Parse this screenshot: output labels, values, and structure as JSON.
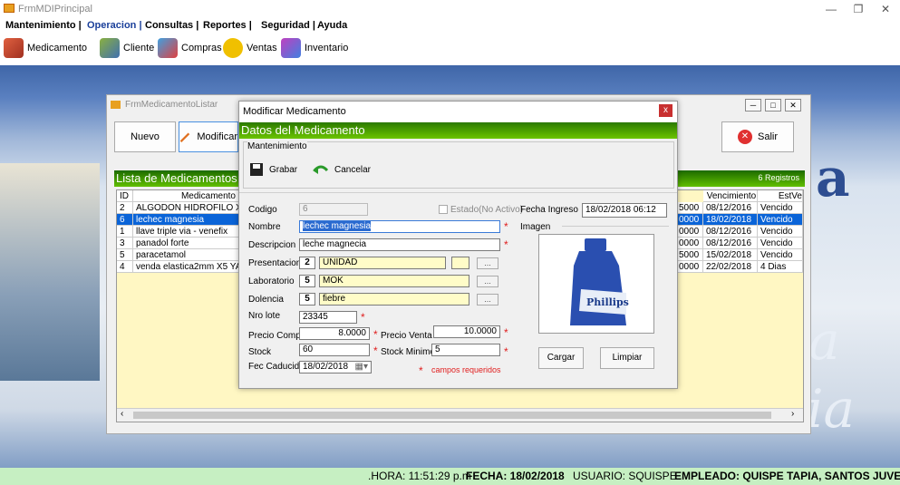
{
  "window": {
    "title": "FrmMDIPrincipal"
  },
  "menu": [
    "Mantenimiento |",
    "Operacion |",
    "Consultas |",
    "Reportes |",
    "Seguridad |",
    "Ayuda"
  ],
  "toolbar": [
    "Medicamento",
    "Cliente",
    "Compras",
    "Ventas",
    "Inventario"
  ],
  "child": {
    "title": "FrmMedicamentoListar",
    "nuevo": "Nuevo",
    "modificar": "Modificar",
    "salir": "Salir",
    "lista_title": "Lista de Medicamentos",
    "count": "6 Registros",
    "columns": {
      "id": "ID",
      "med": "Medicamento",
      "venc": "Vencimiento",
      "est": "EstVe"
    },
    "rows": [
      {
        "id": "2",
        "med": "ALGODON HIDROFILO X 25 G",
        "code": "5000",
        "venc": "08/12/2016",
        "est": "Vencido"
      },
      {
        "id": "6",
        "med": "lechec magnesia",
        "code": "0000",
        "venc": "18/02/2018",
        "est": "Vencido"
      },
      {
        "id": "1",
        "med": "llave triple via - venefix",
        "code": "0000",
        "venc": "08/12/2016",
        "est": "Vencido"
      },
      {
        "id": "3",
        "med": "panadol forte",
        "code": "0000",
        "venc": "08/12/2016",
        "est": "Vencido"
      },
      {
        "id": "5",
        "med": "paracetamol",
        "code": "5000",
        "venc": "15/02/2018",
        "est": "Vencido"
      },
      {
        "id": "4",
        "med": "venda elastica2mm X5 YARDA",
        "code": "0000",
        "venc": "22/02/2018",
        "est": "4 Dias"
      }
    ]
  },
  "modal": {
    "title": "Modificar Medicamento",
    "section": "Datos del Medicamento",
    "group": "Mantenimiento",
    "grabar": "Grabar",
    "cancelar": "Cancelar",
    "labels": {
      "codigo": "Codigo",
      "nombre": "Nombre",
      "descripcion": "Descripcion",
      "presentacion": "Presentacion",
      "laboratorio": "Laboratorio",
      "dolencia": "Dolencia",
      "nro_lote": "Nro lote",
      "precio_compra": "Precio Compra",
      "precio_venta": "Precio Venta",
      "stock": "Stock",
      "stock_minimo": "Stock Minimo",
      "fec_caducidad": "Fec Caducidad",
      "fecha_ingreso": "Fecha Ingreso",
      "imagen": "Imagen",
      "estado": "Estado(No Activo)"
    },
    "values": {
      "codigo": "6",
      "nombre": "lechec magnesia",
      "descripcion": "leche magnecia",
      "presentacion_id": "2",
      "presentacion": "UNIDAD",
      "laboratorio_id": "5",
      "laboratorio": "MOK",
      "dolencia_id": "5",
      "dolencia": "fiebre",
      "nro_lote": "23345",
      "precio_compra": "8.0000",
      "precio_venta": "10.0000",
      "stock": "60",
      "stock_minimo": "5",
      "fec_caducidad": "18/02/2018",
      "fecha_ingreso": "18/02/2018 06:12"
    },
    "dots": "...",
    "required_note": "campos requeridos",
    "cargar": "Cargar",
    "limpiar": "Limpiar",
    "bottle_label": "Phillips"
  },
  "status": {
    "hora": ".HORA: 11:51:29 p.m",
    "fecha": "FECHA: 18/02/2018",
    "usuario": "USUARIO: SQUISPE",
    "empleado": "EMPLEADO: QUISPE TAPIA, SANTOS JUVENAL"
  }
}
